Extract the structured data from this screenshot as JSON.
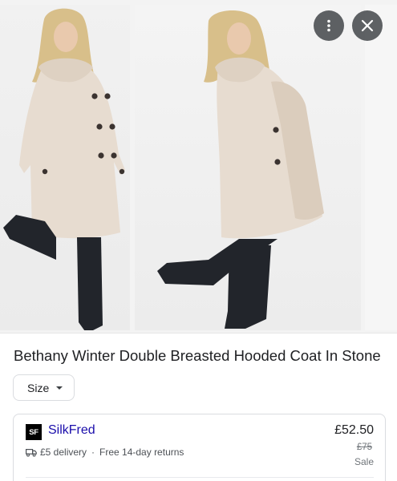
{
  "product": {
    "title": "Bethany Winter Double Breasted Hooded Coat In Stone"
  },
  "gallery": {
    "more_icon": "more-vert-icon",
    "close_icon": "close-icon"
  },
  "filters": {
    "size_label": "Size"
  },
  "offer": {
    "seller_logo_text": "SF",
    "seller_name": "SilkFred",
    "delivery_text": "£5 delivery",
    "separator": "·",
    "returns_text": "Free 14-day returns",
    "price": "£52.50",
    "old_price": "£75",
    "sale_label": "Sale"
  },
  "colors": {
    "link": "#1a0dab",
    "coat": "#e7dcd0",
    "boots": "#22252b"
  }
}
